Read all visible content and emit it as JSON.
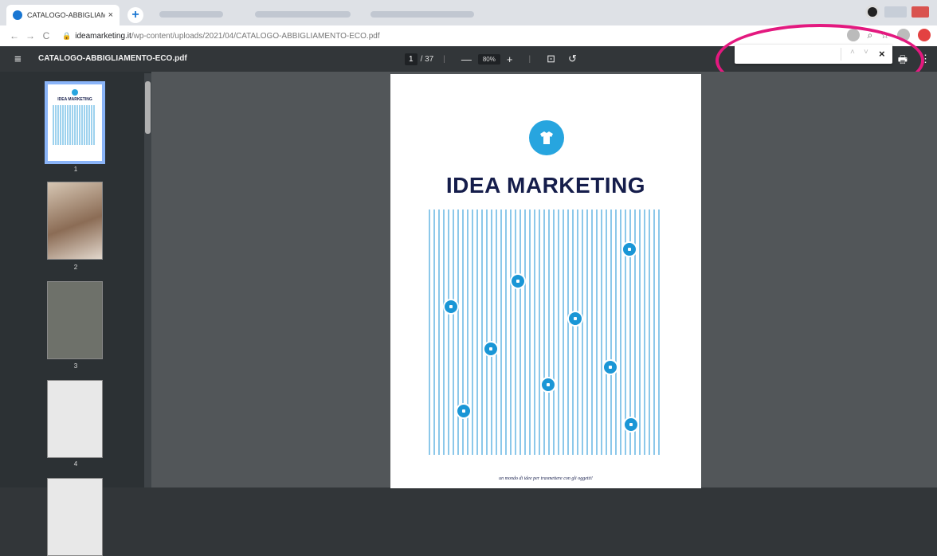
{
  "browser": {
    "active_tab_title": "CATALOGO-ABBIGLIAMENTO-E",
    "close_glyph": "×",
    "newtab_glyph": "+",
    "url_lock": "🔒",
    "url_host": "ideamarketing.it",
    "url_path": "/wp-content/uploads/2021/04/CATALOGO-ABBIGLIAMENTO-ECO.pdf",
    "nav_back": "←",
    "nav_forward": "→",
    "nav_reload": "C"
  },
  "pdf_viewer": {
    "menu_glyph": "≡",
    "file_name": "CATALOGO-ABBIGLIAMENTO-ECO.pdf",
    "current_page": "1",
    "total_pages": "/ 37",
    "zoom_out_glyph": "—",
    "zoom": "80%",
    "zoom_in_glyph": "+",
    "fit_glyph": "⊡",
    "rotate_glyph": "↺",
    "print_glyph": "🖶",
    "more_glyph": "⋮"
  },
  "find_bar": {
    "query": "",
    "prev_glyph": "˄",
    "next_glyph": "˅",
    "close_glyph": "×"
  },
  "thumbnails": [
    {
      "label": "1",
      "mini_title": "IDEA MARKETING"
    },
    {
      "label": "2"
    },
    {
      "label": "3"
    },
    {
      "label": "4"
    }
  ],
  "page": {
    "brand": "IDEA MARKETING",
    "tagline": "un mondo di idee per trasmettere con gli oggetti!"
  },
  "colors": {
    "brand_navy": "#151d4b",
    "brand_blue": "#27a5df",
    "highlight": "#e3197f",
    "thumb_selected": "#8ab4f8"
  }
}
